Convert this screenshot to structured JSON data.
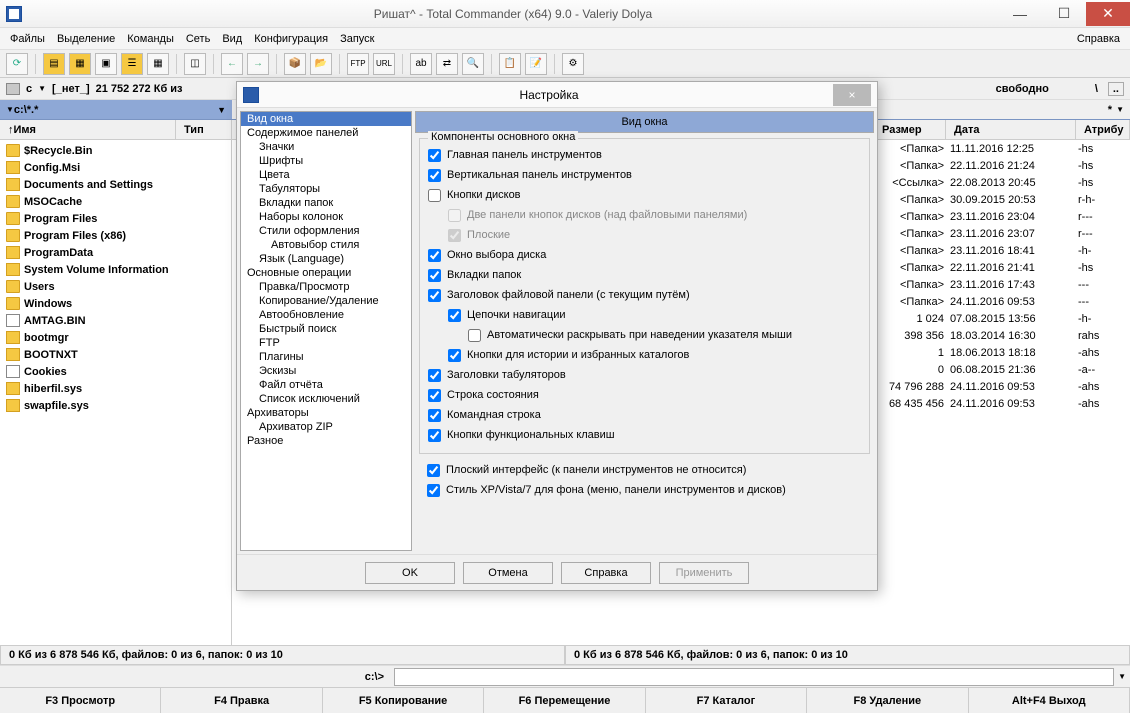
{
  "window": {
    "title": "Ришат^ - Total Commander (x64) 9.0 - Valeriy Dolya"
  },
  "menu": {
    "items": [
      "Файлы",
      "Выделение",
      "Команды",
      "Сеть",
      "Вид",
      "Конфигурация",
      "Запуск"
    ],
    "help": "Справка"
  },
  "drivebar": {
    "drive": "c",
    "label": "[_нет_]",
    "info": "21 752 272 Кб из",
    "right_free": "свободно",
    "right_slash": "\\"
  },
  "path": {
    "left": "c:\\*.*",
    "right": "*"
  },
  "columns": {
    "name": "Имя",
    "ext": "Тип",
    "size": "Размер",
    "date": "Дата",
    "attr": "Атрибу"
  },
  "files": [
    {
      "name": "$Recycle.Bin",
      "icon": "folder"
    },
    {
      "name": "Config.Msi",
      "icon": "warn"
    },
    {
      "name": "Documents and Settings",
      "icon": "warn"
    },
    {
      "name": "MSOCache",
      "icon": "folder"
    },
    {
      "name": "Program Files",
      "icon": "folder"
    },
    {
      "name": "Program Files (x86)",
      "icon": "folder"
    },
    {
      "name": "ProgramData",
      "icon": "warn"
    },
    {
      "name": "System Volume Information",
      "icon": "warn"
    },
    {
      "name": "Users",
      "icon": "folder"
    },
    {
      "name": "Windows",
      "icon": "folder"
    },
    {
      "name": "AMTAG.BIN",
      "icon": "file"
    },
    {
      "name": "bootmgr",
      "icon": "warn"
    },
    {
      "name": "BOOTNXT",
      "icon": "warn"
    },
    {
      "name": "Cookies",
      "icon": "file"
    },
    {
      "name": "hiberfil.sys",
      "icon": "warn"
    },
    {
      "name": "swapfile.sys",
      "icon": "warn"
    }
  ],
  "rightrows": [
    {
      "size": "<Папка>",
      "date": "11.11.2016 12:25",
      "attr": "-hs"
    },
    {
      "size": "<Папка>",
      "date": "22.11.2016 21:24",
      "attr": "-hs"
    },
    {
      "size": "<Ссылка>",
      "date": "22.08.2013 20:45",
      "attr": "-hs"
    },
    {
      "size": "<Папка>",
      "date": "30.09.2015 20:53",
      "attr": "r-h-"
    },
    {
      "size": "<Папка>",
      "date": "23.11.2016 23:04",
      "attr": "r---"
    },
    {
      "size": "<Папка>",
      "date": "23.11.2016 23:07",
      "attr": "r---"
    },
    {
      "size": "<Папка>",
      "date": "23.11.2016 18:41",
      "attr": "-h-"
    },
    {
      "size": "<Папка>",
      "date": "22.11.2016 21:41",
      "attr": "-hs"
    },
    {
      "size": "<Папка>",
      "date": "23.11.2016 17:43",
      "attr": "---"
    },
    {
      "size": "<Папка>",
      "date": "24.11.2016 09:53",
      "attr": "---"
    },
    {
      "size": "1 024",
      "date": "07.08.2015 13:56",
      "attr": "-h-"
    },
    {
      "size": "398 356",
      "date": "18.03.2014 16:30",
      "attr": "rahs"
    },
    {
      "size": "1",
      "date": "18.06.2013 18:18",
      "attr": "-ahs"
    },
    {
      "size": "0",
      "date": "06.08.2015 21:36",
      "attr": "-a--"
    },
    {
      "size": "74 796 288",
      "date": "24.11.2016 09:53",
      "attr": "-ahs"
    },
    {
      "size": "68 435 456",
      "date": "24.11.2016 09:53",
      "attr": "-ahs"
    }
  ],
  "status": {
    "left": "0 Кб из 6 878 546 Кб, файлов: 0 из 6, папок: 0 из 10",
    "right": "0 Кб из 6 878 546 Кб, файлов: 0 из 6, папок: 0 из 10"
  },
  "cmdline": {
    "prompt": "c:\\>"
  },
  "fkeys": [
    "F3 Просмотр",
    "F4 Правка",
    "F5 Копирование",
    "F6 Перемещение",
    "F7 Каталог",
    "F8 Удаление",
    "Alt+F4 Выход"
  ],
  "dialog": {
    "title": "Настройка",
    "close": "×",
    "tree": [
      {
        "t": "Вид окна",
        "sel": true
      },
      {
        "t": "Содержимое панелей"
      },
      {
        "t": "Значки",
        "i": 1
      },
      {
        "t": "Шрифты",
        "i": 1
      },
      {
        "t": "Цвета",
        "i": 1
      },
      {
        "t": "Табуляторы",
        "i": 1
      },
      {
        "t": "Вкладки папок",
        "i": 1
      },
      {
        "t": "Наборы колонок",
        "i": 1
      },
      {
        "t": "Стили оформления",
        "i": 1
      },
      {
        "t": "Автовыбор стиля",
        "i": 2
      },
      {
        "t": "Язык (Language)",
        "i": 1
      },
      {
        "t": "Основные операции"
      },
      {
        "t": "Правка/Просмотр",
        "i": 1
      },
      {
        "t": "Копирование/Удаление",
        "i": 1
      },
      {
        "t": "Автообновление",
        "i": 1
      },
      {
        "t": "Быстрый поиск",
        "i": 1
      },
      {
        "t": "FTP",
        "i": 1
      },
      {
        "t": "Плагины",
        "i": 1
      },
      {
        "t": "Эскизы",
        "i": 1
      },
      {
        "t": "Файл отчёта",
        "i": 1
      },
      {
        "t": "Список исключений",
        "i": 1
      },
      {
        "t": "Архиваторы"
      },
      {
        "t": "Архиватор ZIP",
        "i": 1
      },
      {
        "t": "Разное"
      }
    ],
    "header": "Вид окна",
    "group": "Компоненты основного окна",
    "opts": {
      "main_toolbar": "Главная панель инструментов",
      "vert_toolbar": "Вертикальная панель инструментов",
      "drive_buttons": "Кнопки дисков",
      "two_panels": "Две панели кнопок дисков (над файловыми панелями)",
      "flat": "Плоские",
      "drive_combo": "Окно выбора диска",
      "folder_tabs": "Вкладки папок",
      "panel_header": "Заголовок файловой панели (с текущим путём)",
      "breadcrumb": "Цепочки навигации",
      "auto_expand": "Автоматически раскрывать при наведении указателя мыши",
      "history_buttons": "Кнопки для истории и избранных каталогов",
      "tab_headers": "Заголовки табуляторов",
      "status": "Строка состояния",
      "cmdline": "Командная строка",
      "fkeys": "Кнопки функциональных клавиш",
      "flat_ui": "Плоский интерфейс (к панели инструментов не относится)",
      "xp_style": "Стиль XP/Vista/7 для фона (меню, панели инструментов и дисков)"
    },
    "buttons": {
      "ok": "OK",
      "cancel": "Отмена",
      "help": "Справка",
      "apply": "Применить"
    }
  }
}
